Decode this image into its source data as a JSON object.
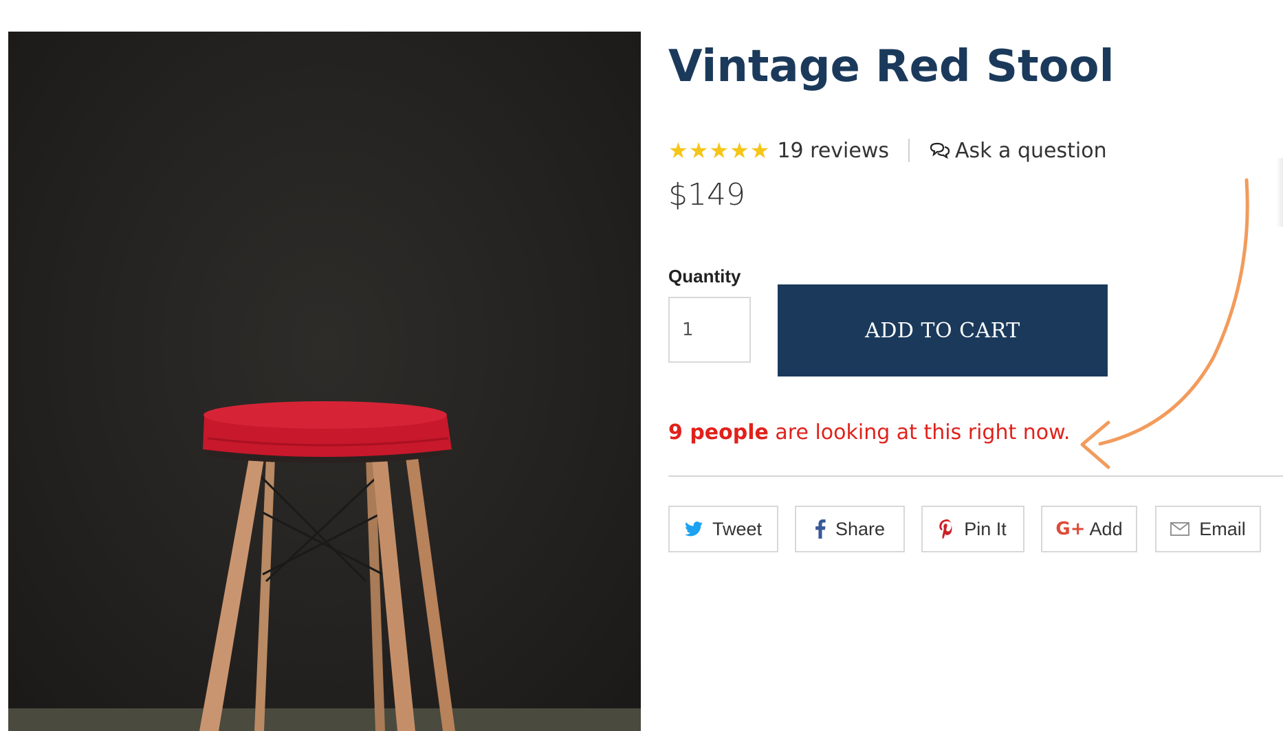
{
  "product": {
    "title": "Vintage Red Stool",
    "rating_stars": "★★★★★",
    "reviews_label": "19 reviews",
    "ask_label": "Ask a question",
    "price": "$149"
  },
  "purchase": {
    "quantity_label": "Quantity",
    "quantity_value": "1",
    "add_to_cart_label": "ADD TO CART"
  },
  "social_proof": {
    "count_text": "9 people",
    "rest_text": " are looking at this right now."
  },
  "share": {
    "tweet": "Tweet",
    "share": "Share",
    "pin": "Pin It",
    "gplus": "Add",
    "email": "Email"
  },
  "colors": {
    "brand_navy": "#1b3a5b",
    "star_gold": "#f5c518",
    "alert_red": "#e0211b",
    "arrow_orange": "#f29b5c",
    "stool_red": "#c8182b"
  },
  "icons": [
    "star-icon",
    "chat-bubbles-icon",
    "twitter-icon",
    "facebook-icon",
    "pinterest-icon",
    "google-plus-icon",
    "email-icon",
    "hand-drawn-arrow"
  ]
}
